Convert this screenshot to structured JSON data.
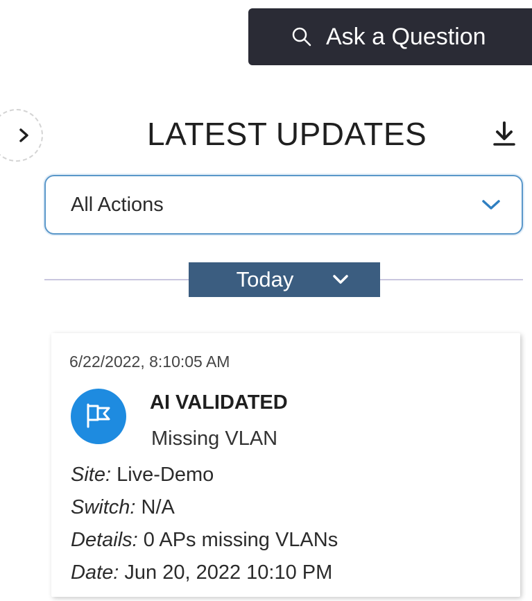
{
  "header": {
    "ask_label": "Ask a Question",
    "search_icon": "search-icon"
  },
  "panel": {
    "title": "LATEST UPDATES",
    "collapse_icon": "chevron-right-icon",
    "download_icon": "download-icon"
  },
  "filter": {
    "selected": "All Actions",
    "dropdown_icon": "chevron-down-icon"
  },
  "group": {
    "label": "Today",
    "toggle_icon": "chevron-down-icon"
  },
  "card": {
    "timestamp": "6/22/2022, 8:10:05 AM",
    "badge_icon": "ai-flag-icon",
    "badge_color": "#1e8be0",
    "status": "AI VALIDATED",
    "subtitle": "Missing VLAN",
    "fields": [
      {
        "key": "Site:",
        "value": "Live-Demo"
      },
      {
        "key": "Switch:",
        "value": "N/A"
      },
      {
        "key": "Details:",
        "value": "0 APs missing VLANs"
      },
      {
        "key": "Date:",
        "value": "Jun 20, 2022 10:10 PM"
      }
    ]
  },
  "colors": {
    "ask_bg": "#2a2b35",
    "filter_border": "#5a97c9",
    "group_bg": "#3b5d80",
    "divider": "#c9c6de"
  }
}
